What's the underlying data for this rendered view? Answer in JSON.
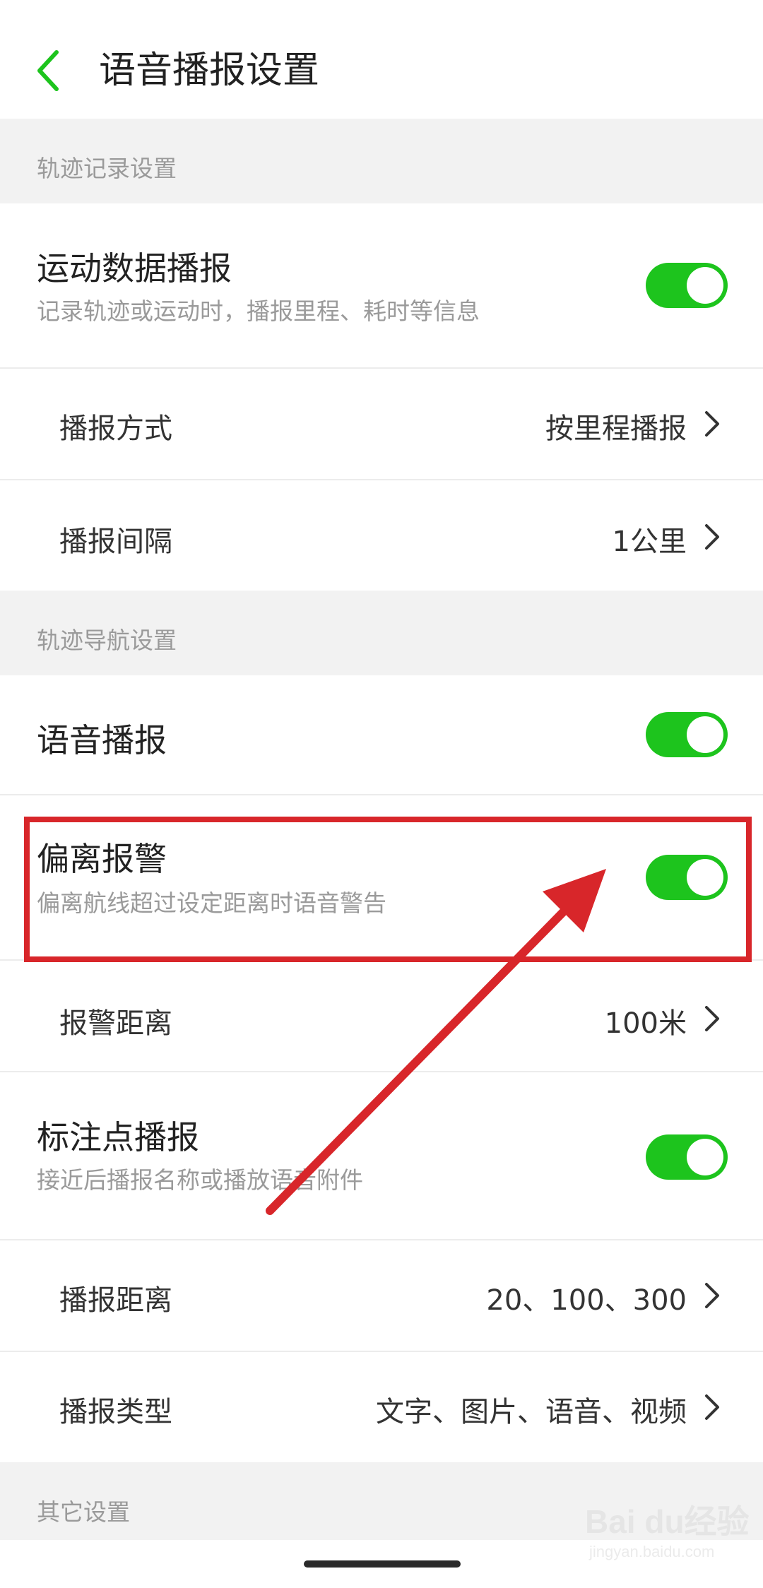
{
  "colors": {
    "accent": "#1dc41d",
    "annotation_red": "#d8262a",
    "section_bg": "#f2f2f2"
  },
  "header": {
    "back_icon": "chevron-left-icon",
    "title": "语音播报设置"
  },
  "sections": [
    {
      "label": "轨迹记录设置"
    },
    {
      "label": "轨迹导航设置"
    },
    {
      "label": "其它设置"
    }
  ],
  "rows": {
    "sport_data": {
      "title": "运动数据播报",
      "subtitle": "记录轨迹或运动时，播报里程、耗时等信息",
      "enabled": true
    },
    "broadcast_mode": {
      "title": "播报方式",
      "value": "按里程播报"
    },
    "broadcast_interval": {
      "title": "播报间隔",
      "value": "1公里"
    },
    "voice_broadcast": {
      "title": "语音播报",
      "enabled": true
    },
    "deviation_alarm": {
      "title": "偏离报警",
      "subtitle": "偏离航线超过设定距离时语音警告",
      "enabled": true
    },
    "alarm_distance": {
      "title": "报警距离",
      "value": "100米"
    },
    "waypoint_broadcast": {
      "title": "标注点播报",
      "subtitle": "接近后播报名称或播放语音附件",
      "enabled": true
    },
    "broadcast_distance": {
      "title": "播报距离",
      "value": "20、100、300"
    },
    "broadcast_type": {
      "title": "播报类型",
      "value": "文字、图片、语音、视频"
    }
  },
  "watermark": {
    "brand": "Bai du经验",
    "url": "jingyan.baidu.com"
  }
}
